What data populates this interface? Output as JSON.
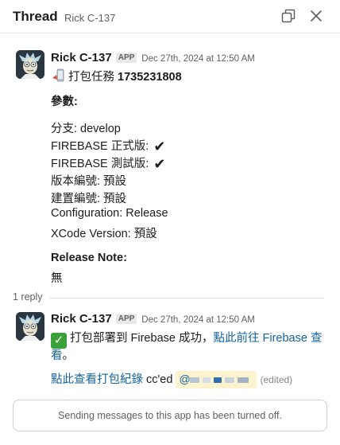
{
  "header": {
    "title": "Thread",
    "channel": "Rick C-137"
  },
  "icons": {
    "popout": "popout-window-icon",
    "close": "close-icon",
    "phone": "mobile-phone-icon",
    "checkmark": "heavy-check-mark",
    "white_check": "white-check-mark-emoji"
  },
  "parent_message": {
    "sender": "Rick C-137",
    "badge": "APP",
    "timestamp": "Dec 27th, 2024 at 12:50 AM",
    "task_prefix": "打包任務",
    "task_id": "1735231808",
    "params_heading": "參數:",
    "branch": "分支: develop",
    "firebase_prod": "FIREBASE 正式版:",
    "firebase_test": "FIREBASE 測試版:",
    "version": "版本編號: 預設",
    "build": "建置編號: 預設",
    "configuration": "Configuration: Release",
    "xcode": "XCode Version: 預設",
    "release_note_heading": "Release Note:",
    "release_note": "無"
  },
  "reply_count": "1 reply",
  "reply_message": {
    "sender": "Rick C-137",
    "badge": "APP",
    "timestamp": "Dec 27th, 2024 at 12:50 AM",
    "text_before": "打包部署到 Firebase 成功，",
    "link1_part1": "點此前往 Firebase 查",
    "link1_part2": "看",
    "text_after": "。",
    "link2": "點此查看打包紀錄",
    "cced": "cc'ed",
    "mention_at": "@",
    "edited": "(edited)"
  },
  "footer": {
    "notice": "Sending messages to this app has been turned off."
  },
  "colors": {
    "link": "#1264a3",
    "mention_bg": "#fdf3cf",
    "check_green": "#3aa03a"
  }
}
